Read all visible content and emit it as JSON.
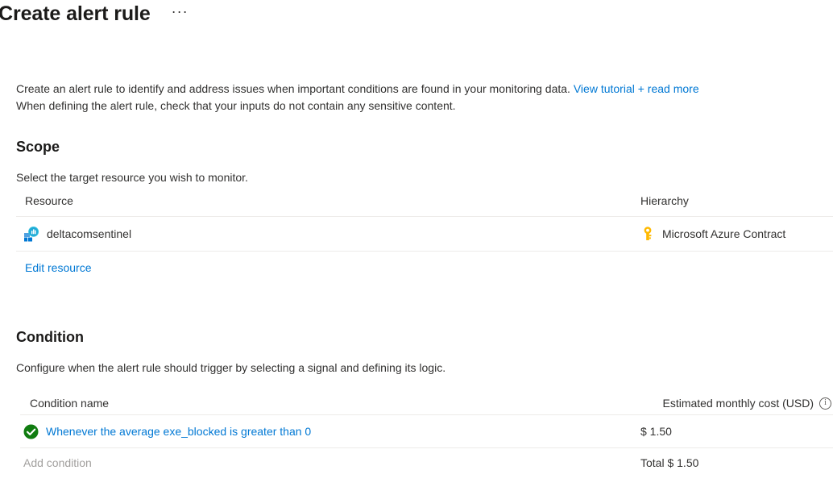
{
  "header": {
    "title": "Create alert rule",
    "more_menu": "···",
    "more_menu_name": "more-options-icon"
  },
  "intro": {
    "line1_text": "Create an alert rule to identify and address issues when important conditions are found in your monitoring data.",
    "line1_link": "View tutorial + read more",
    "line2_text": "When defining the alert rule, check that your inputs do not contain any sensitive content."
  },
  "scope": {
    "heading": "Scope",
    "subtitle": "Select the target resource you wish to monitor.",
    "columns": {
      "resource": "Resource",
      "hierarchy": "Hierarchy"
    },
    "rows": [
      {
        "resource_name": "deltacomsentinel",
        "resource_icon": "log-analytics-workspace-icon",
        "hierarchy_name": "Microsoft Azure Contract",
        "hierarchy_icon": "subscription-key-icon",
        "hierarchy_chevron": "›"
      }
    ],
    "edit_link": "Edit resource"
  },
  "condition": {
    "heading": "Condition",
    "subtitle": "Configure when the alert rule should trigger by selecting a signal and defining its logic.",
    "columns": {
      "name": "Condition name",
      "cost": "Estimated monthly cost (USD)",
      "cost_info_icon": "i"
    },
    "rows": [
      {
        "status_icon": "success-check-icon",
        "name": "Whenever the average exe_blocked is greater than 0",
        "cost": "$ 1.50"
      }
    ],
    "add_label": "Add condition",
    "total_label": "Total $ 1.50"
  },
  "colors": {
    "link": "#0078d4",
    "success": "#107c10",
    "key_icon": "#ffb900",
    "text": "#323130",
    "muted": "#a19f9d",
    "divider": "#edebe9"
  }
}
